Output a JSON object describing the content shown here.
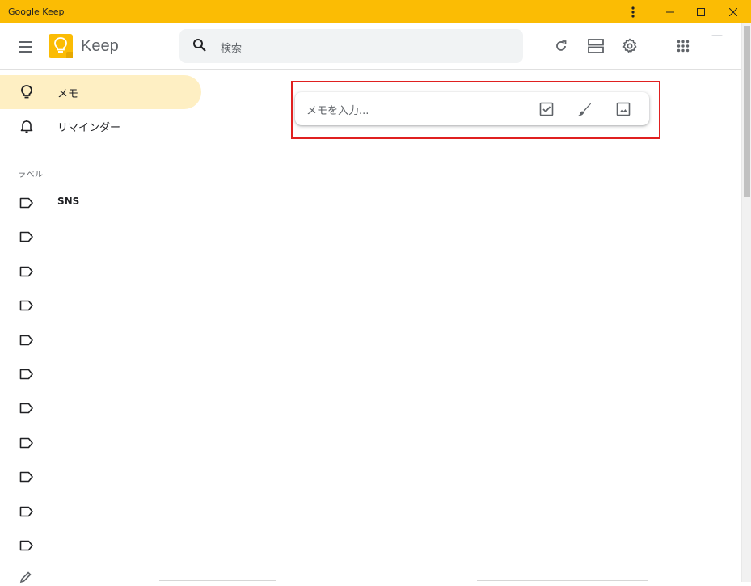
{
  "window": {
    "title": "Google Keep"
  },
  "appbar": {
    "app_name": "Keep",
    "search_placeholder": "検索"
  },
  "sidebar": {
    "items": [
      {
        "label": "メモ",
        "icon": "lightbulb-icon",
        "active": true
      },
      {
        "label": "リマインダー",
        "icon": "bell-icon",
        "active": false
      }
    ],
    "labels_header": "ラベル",
    "labels": [
      "SNS",
      "",
      "",
      "",
      "",
      "",
      "",
      "",
      "",
      "",
      ""
    ]
  },
  "note_input": {
    "placeholder": "メモを入力..."
  },
  "colors": {
    "titlebar": "#fbbc04",
    "active_nav": "#feefc3",
    "highlight_border": "#e02020"
  }
}
